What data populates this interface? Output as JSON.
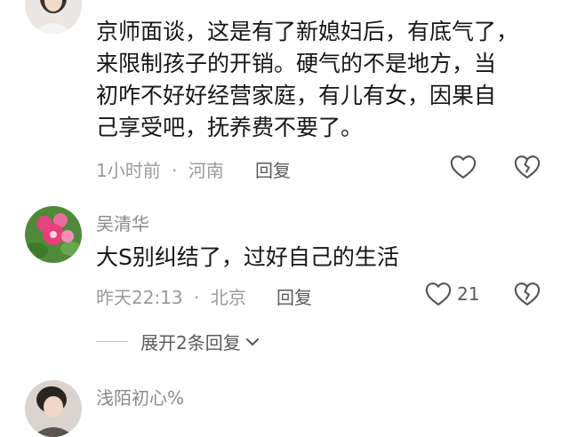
{
  "comments": [
    {
      "username": "",
      "text": "京师面谈，这是有了新媳妇后，有底气了，\n来限制孩子的开销。硬气的不是地方，当\n初咋不好好经营家庭，有儿有女，因果自\n己享受吧，抚养费不要了。",
      "time": "1小时前",
      "location": "河南",
      "reply_label": "回复",
      "likes": ""
    },
    {
      "username": "吴清华",
      "text": "大S别纠结了，过好自己的生活",
      "time": "昨天22:13",
      "location": "北京",
      "reply_label": "回复",
      "likes": "21"
    },
    {
      "username": "浅陌初心%",
      "text": "",
      "time": "",
      "location": "",
      "reply_label": "",
      "likes": ""
    }
  ],
  "separator": "·",
  "expand_replies_label": "展开2条回复",
  "icons": {
    "like": "heart-outline-icon",
    "dislike": "broken-heart-icon",
    "expand": "chevron-down-icon"
  },
  "colors": {
    "text": "#161616",
    "meta": "#9a9a9a",
    "username": "#8a8a8a"
  }
}
